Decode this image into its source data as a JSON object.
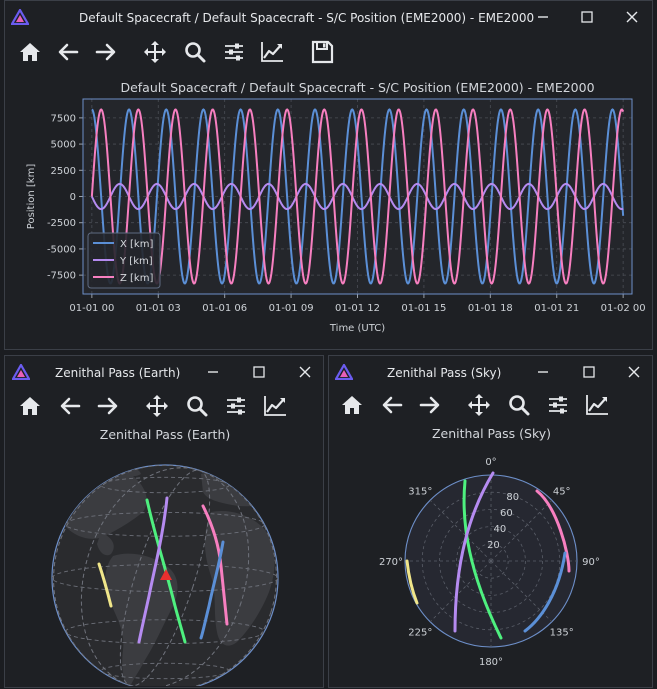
{
  "top_window": {
    "title": "Default Spacecraft / Default Spacecraft - S/C Position (EME2000) - EME2000",
    "plot_title": "Default Spacecraft / Default Spacecraft - S/C Position (EME2000) - EME2000",
    "toolbar": [
      "home-icon",
      "back-arrow-icon",
      "forward-arrow-icon",
      "pan-icon",
      "zoom-icon",
      "configure-subplots-icon",
      "edit-axis-icon",
      "save-icon"
    ]
  },
  "earth_window": {
    "title": "Zenithal Pass (Earth)",
    "plot_title": "Zenithal Pass (Earth)",
    "toolbar": [
      "home-icon",
      "back-arrow-icon",
      "forward-arrow-icon",
      "pan-icon",
      "zoom-icon",
      "configure-subplots-icon",
      "edit-axis-icon"
    ]
  },
  "sky_window": {
    "title": "Zenithal Pass (Sky)",
    "plot_title": "Zenithal Pass (Sky)",
    "toolbar": [
      "home-icon",
      "back-arrow-icon",
      "forward-arrow-icon",
      "pan-icon",
      "zoom-icon",
      "configure-subplots-icon",
      "edit-axis-icon"
    ]
  },
  "colors": {
    "x_series": "#5b8fd6",
    "y_series": "#b58bf0",
    "z_series": "#f77fc0",
    "green": "#4ef07f",
    "yellow": "#f0e68a",
    "marker": "#e8302f",
    "plot_border": "#6d8fc9",
    "bg": "#1e2024"
  },
  "chart_data": [
    {
      "type": "line",
      "title": "Default Spacecraft / Default Spacecraft - S/C Position (EME2000) - EME2000",
      "xlabel": "Time (UTC)",
      "ylabel": "Position [km]",
      "x_tick_labels": [
        "01-01 00",
        "01-01 03",
        "01-01 06",
        "01-01 09",
        "01-01 12",
        "01-01 15",
        "01-01 18",
        "01-01 21",
        "01-02 00"
      ],
      "y_ticks": [
        7500,
        5000,
        2500,
        0,
        -2500,
        -5000,
        -7500
      ],
      "xlim_hours": [
        -0.4,
        24.4
      ],
      "ylim": [
        -9300,
        9300
      ],
      "grid": true,
      "legend_position": "lower-left",
      "period_hours": 1.68,
      "series": [
        {
          "name": "X [km]",
          "amplitude": 8300,
          "phase_deg": 90,
          "color": "#5b8fd6"
        },
        {
          "name": "Y [km]",
          "amplitude": 1200,
          "phase_deg": 180,
          "color": "#b58bf0"
        },
        {
          "name": "Z [km]",
          "amplitude": 8300,
          "phase_deg": 0,
          "color": "#f77fc0"
        }
      ]
    },
    {
      "type": "polar",
      "title": "Zenithal Pass (Sky)",
      "angle_labels": [
        "0°",
        "45°",
        "90°",
        "135°",
        "180°",
        "225°",
        "270°",
        "315°"
      ],
      "radial_labels": [
        "20",
        "40",
        "60",
        "80"
      ]
    }
  ]
}
